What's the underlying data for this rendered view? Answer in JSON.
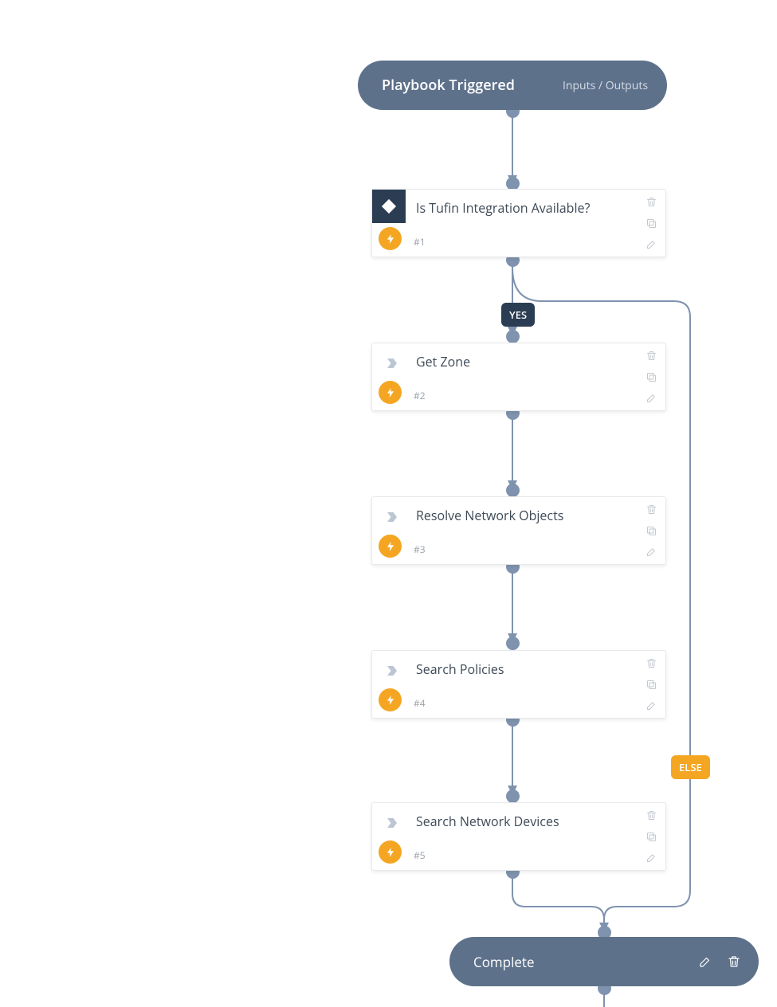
{
  "header": {
    "title": "Playbook Triggered",
    "io_link": "Inputs / Outputs"
  },
  "branches": {
    "yes": "YES",
    "else": "ELSE"
  },
  "steps": [
    {
      "index": "#1",
      "title": "Is Tufin Integration Available?",
      "type": "condition"
    },
    {
      "index": "#2",
      "title": "Get Zone",
      "type": "action"
    },
    {
      "index": "#3",
      "title": "Resolve Network Objects",
      "type": "action"
    },
    {
      "index": "#4",
      "title": "Search Policies",
      "type": "action"
    },
    {
      "index": "#5",
      "title": "Search Network Devices",
      "type": "action"
    }
  ],
  "footer": {
    "label": "Complete"
  },
  "colors": {
    "pill": "#5e718b",
    "connector": "#7f92ae",
    "badge_dark": "#2b3d52",
    "badge_orange": "#f4a623",
    "card_border": "#e6e8ea",
    "text_title": "#3e4a56",
    "text_meta": "#9aa1a9",
    "icon_muted": "#c3c8cf"
  }
}
